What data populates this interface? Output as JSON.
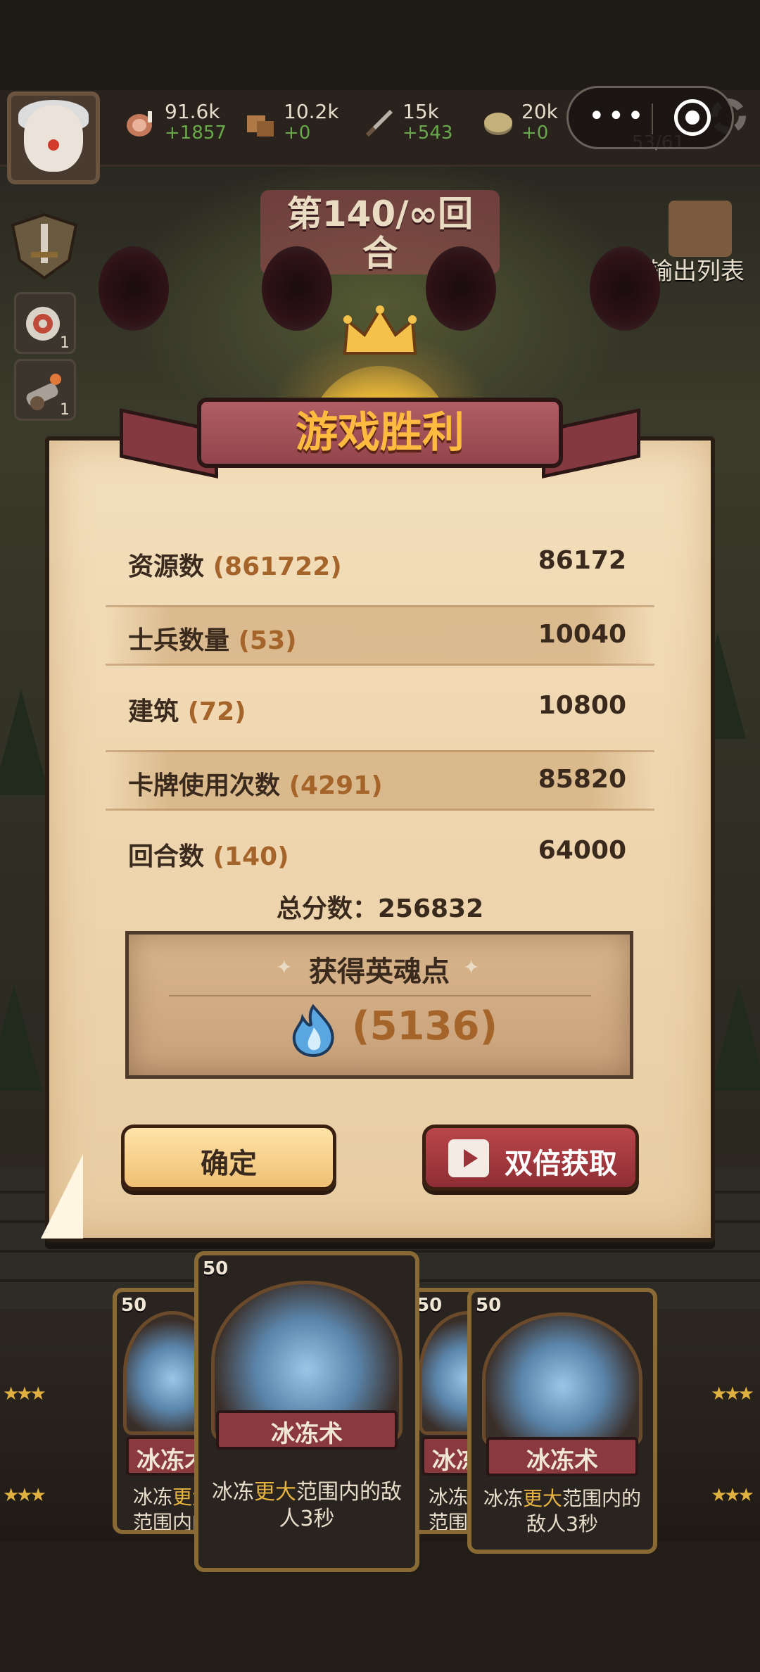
{
  "resources": [
    {
      "name": "meat-icon",
      "value": "91.6k",
      "delta": "+1857"
    },
    {
      "name": "wood-icon",
      "value": "10.2k",
      "delta": "+0"
    },
    {
      "name": "sword-icon",
      "value": "15k",
      "delta": "+543"
    },
    {
      "name": "coin-icon",
      "value": "20k",
      "delta": "+0"
    }
  ],
  "population": "53/61",
  "round": {
    "label": "第140/∞回合"
  },
  "output_list": "输出列表",
  "left_tools": [
    {
      "name": "target-icon",
      "count": "1"
    },
    {
      "name": "cannon-icon",
      "count": "1"
    }
  ],
  "dialog": {
    "title": "游戏胜利",
    "rows": [
      {
        "label": "资源数",
        "count": "(861722)",
        "value": "86172"
      },
      {
        "label": "士兵数量",
        "count": "(53)",
        "value": "10040"
      },
      {
        "label": "建筑",
        "count": "(72)",
        "value": "10800"
      },
      {
        "label": "卡牌使用次数",
        "count": "(4291)",
        "value": "85820"
      },
      {
        "label": "回合数",
        "count": "(140)",
        "value": "64000"
      }
    ],
    "total_label": "总分数：",
    "total_value": "256832",
    "soul": {
      "title": "获得英魂点",
      "value": "(5136)"
    },
    "confirm_label": "确定",
    "double_label": "双倍获取"
  },
  "cards": [
    {
      "cost": "50",
      "name": "冰冻术",
      "desc_pre": "冰冻",
      "desc_hl": "更大",
      "desc_post": "范围内的敌人3秒"
    },
    {
      "cost": "50",
      "name": "冰冻术",
      "desc_pre": "冰冻",
      "desc_hl": "更大",
      "desc_post": "范围内的敌人3秒"
    },
    {
      "cost": "50",
      "name": "冰冻术",
      "desc_pre": "冰冻",
      "desc_hl": "更大",
      "desc_post": "范围内的敌人3秒"
    },
    {
      "cost": "50",
      "name": "冰冻术",
      "desc_pre": "冰冻",
      "desc_hl": "更大",
      "desc_post": "范围内的敌人3秒"
    }
  ],
  "colors": {
    "accent_gold": "#ffbb40",
    "count_brown": "#a5652a",
    "ribbon_red": "#92444c",
    "resource_delta_green": "#67a84a"
  }
}
